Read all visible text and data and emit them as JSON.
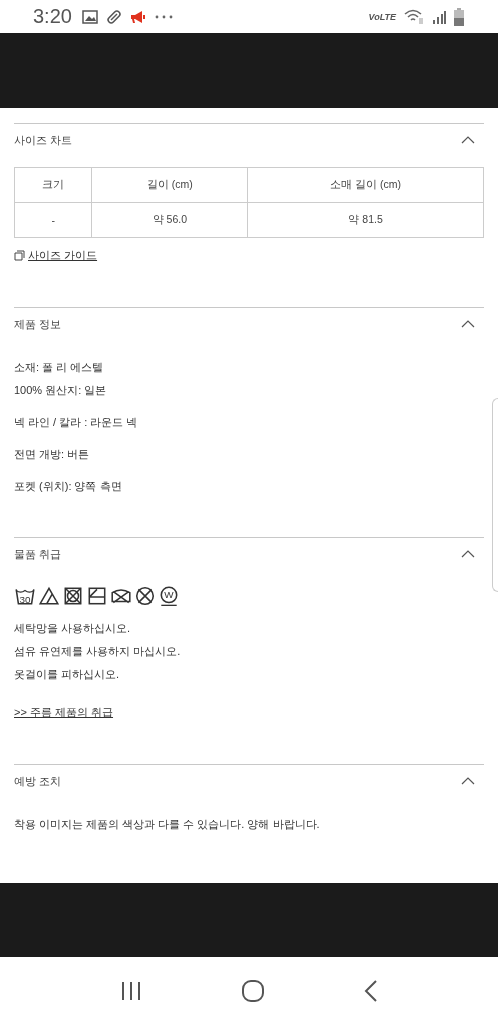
{
  "status_bar": {
    "time": "3:20",
    "network_label": "VoLTE"
  },
  "sections": [
    {
      "title": "사이즈 차트",
      "expanded": true,
      "kind": "size_chart",
      "table": {
        "columns": [
          "크기",
          "길이 (cm)",
          "소매 길이 (cm)"
        ],
        "rows": [
          [
            "-",
            "약 56.0",
            "약 81.5"
          ]
        ]
      },
      "link": "사이즈 가이드"
    },
    {
      "title": "제품 정보",
      "expanded": true,
      "kind": "text",
      "paragraphs": [
        [
          "소재: 폴 리 에스텔",
          "100% 원산지: 일본"
        ],
        [
          "넥 라인 / 칼라 : 라운드 넥"
        ],
        [
          "전면 개방: 버튼"
        ],
        [
          "포켓 (위치): 양쪽 측면"
        ]
      ]
    },
    {
      "title": "물품 취급",
      "expanded": true,
      "kind": "care",
      "care_icons": [
        {
          "kind": "wash",
          "label": "30"
        },
        {
          "kind": "bleach"
        },
        {
          "kind": "no_tumble"
        },
        {
          "kind": "dry"
        },
        {
          "kind": "no_wring"
        },
        {
          "kind": "no_dryclean"
        },
        {
          "kind": "wetclean",
          "label": "W"
        }
      ],
      "paragraphs": [
        [
          "세탁망을 사용하십시오.",
          "섬유 유연제를 사용하지 마십시오.",
          "옷걸이를 피하십시오."
        ]
      ],
      "link": ">> 주름 제품의 취급"
    },
    {
      "title": "예방 조치",
      "expanded": true,
      "kind": "text",
      "paragraphs": [
        [
          "착용 이미지는 제품의 색상과 다를 수 있습니다. 양해 바랍니다."
        ]
      ]
    }
  ]
}
